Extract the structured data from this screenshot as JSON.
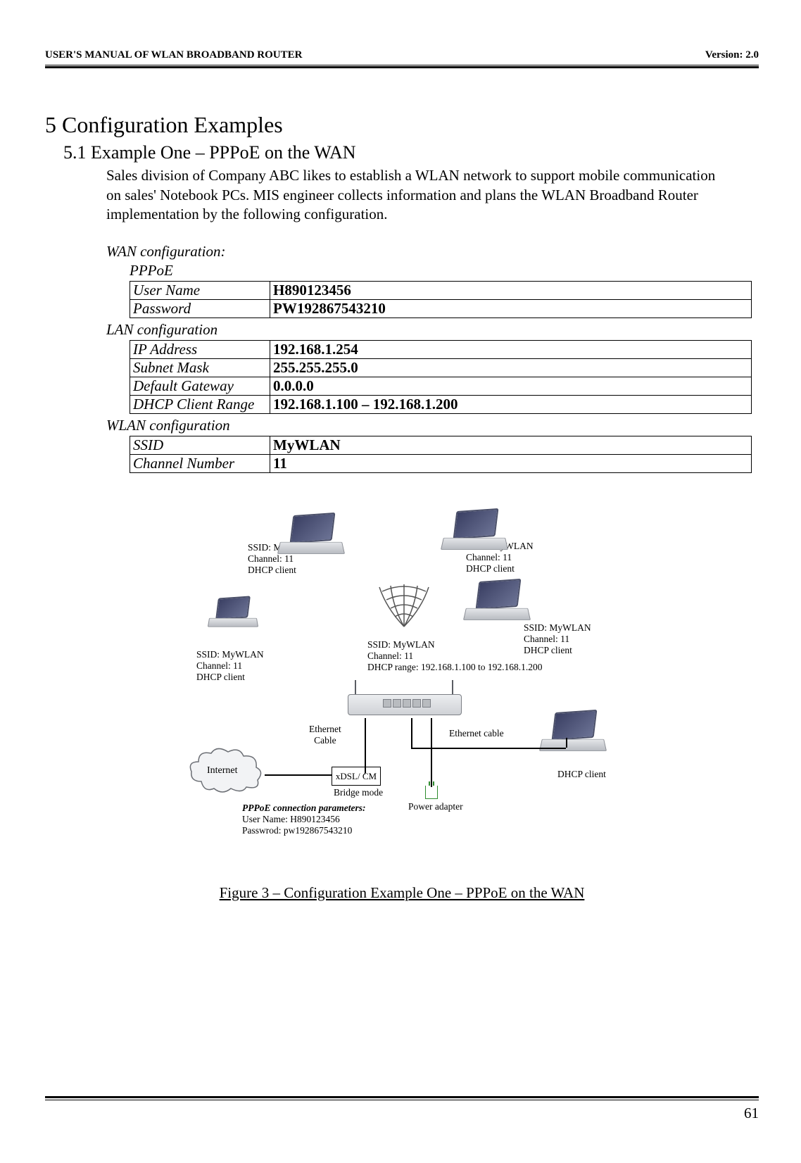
{
  "header": {
    "left": "USER'S MANUAL OF WLAN BROADBAND ROUTER",
    "right": "Version: 2.0"
  },
  "chapter": "5 Configuration Examples",
  "section": "5.1 Example One – PPPoE on the WAN",
  "body": "Sales division of Company ABC likes to establish a WLAN network to support mobile communication on sales' Notebook PCs. MIS engineer collects information and plans the WLAN Broadband Router implementation by the following configuration.",
  "wan": {
    "heading": "WAN configuration:",
    "sub": "PPPoE",
    "rows": [
      {
        "label": "User Name",
        "value": "H890123456"
      },
      {
        "label": "Password",
        "value": "PW192867543210"
      }
    ]
  },
  "lan": {
    "heading": "LAN configuration",
    "rows": [
      {
        "label": "IP Address",
        "value": "192.168.1.254"
      },
      {
        "label": "Subnet Mask",
        "value": "255.255.255.0"
      },
      {
        "label": "Default Gateway",
        "value": "0.0.0.0"
      },
      {
        "label": "DHCP Client Range",
        "value": "192.168.1.100 – 192.168.1.200"
      }
    ]
  },
  "wlan": {
    "heading": "WLAN configuration",
    "rows": [
      {
        "label": "SSID",
        "value": "MyWLAN"
      },
      {
        "label": "Channel Number",
        "value": "11"
      }
    ]
  },
  "diagram": {
    "client1": {
      "l1": "SSID: MyWLAN",
      "l2": "Channel: 11",
      "l3": "DHCP client"
    },
    "client2": {
      "l1": "SSID: MyWLAN",
      "l2": "Channel: 11",
      "l3": "DHCP client"
    },
    "client3": {
      "l1": "SSID: MyWLAN",
      "l2": "Channel: 11",
      "l3": "DHCP client"
    },
    "client4": {
      "l1": "SSID: MyWLAN",
      "l2": "Channel: 11",
      "l3": "DHCP client"
    },
    "router": {
      "l1": "SSID: MyWLAN",
      "l2": "Channel: 11",
      "l3": "DHCP range: 192.168.1.100 to 192.168.1.200"
    },
    "eth_cable_left": "Ethernet\nCable",
    "eth_cable_right": "Ethernet cable",
    "internet": "Internet",
    "xdsl": "xDSL/ CM",
    "bridge": "Bridge mode",
    "power": "Power adapter",
    "wired_client": "DHCP client",
    "pppoe_title": "PPPoE connection parameters:",
    "pppoe_user": "User Name: H890123456",
    "pppoe_pass": "Passwrod: pw192867543210"
  },
  "figure_caption": "Figure 3 – Configuration Example One – PPPoE on the WAN",
  "page_number": "61"
}
